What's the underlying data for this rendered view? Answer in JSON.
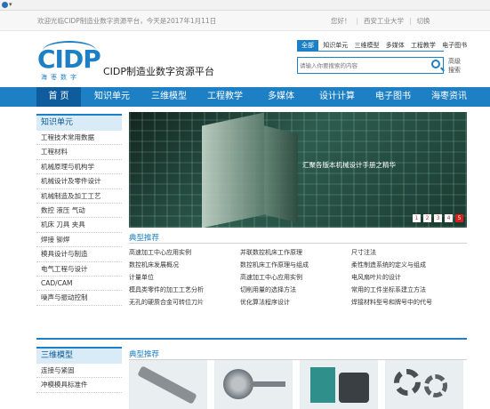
{
  "top": {
    "welcome": "欢迎光临CIDP制造业数字资源平台，今天是2017年1月11日",
    "greeting": "您好！",
    "org": "西安工业大学",
    "switch": "切换"
  },
  "logo": {
    "mark": "CIDP",
    "sub": "海枣数字"
  },
  "site_title": "CIDP制造业数字资源平台",
  "search": {
    "tabs": [
      "全部",
      "知识单元",
      "三维模型",
      "多媒体",
      "工程教学",
      "电子图书"
    ],
    "placeholder": "请输入你要搜索的内容",
    "advanced": "高级搜索"
  },
  "nav": [
    "首 页",
    "知识单元",
    "三维模型",
    "工程教学",
    "多媒体",
    "设计计算",
    "电子图书",
    "海枣资讯"
  ],
  "sidebar1": {
    "title": "知识单元",
    "items": [
      "工程技术常用数据",
      "工程材料",
      "机械原理与机构学",
      "机械设计及零件设计",
      "机械制造及加工工艺",
      "数控 液压 气动",
      "机床 刀具 夹具",
      "焊接 铆焊",
      "模具设计与制造",
      "电气工程与设计",
      "CAD/CAM",
      "噪声与振动控制"
    ]
  },
  "banner": {
    "caption": "汇聚各版本机械设计手册之精华",
    "pages": [
      "1",
      "2",
      "3",
      "4",
      "5"
    ]
  },
  "rec1": {
    "title": "典型推荐",
    "items": [
      "高速加工中心应用实例",
      "并联数控机床工作原理",
      "尺寸注法",
      "数控机床发展概况",
      "数控机床工作原理与组成",
      "柔性制造系统的定义与组成",
      "计量单位",
      "高速加工中心应用实例",
      "电风扇叶片的设计",
      "模具类零件的加工工艺分析",
      "切削用量的选择方法",
      "常用的工件坐标系建立方法",
      "无孔的硬质合金可转位刀片",
      "优化算法程序设计",
      "焊接材料型号和牌号中的代号"
    ]
  },
  "sidebar2": {
    "title": "三维模型",
    "items": [
      "连接与紧固",
      "冲模模具标准件"
    ]
  },
  "rec2": {
    "title": "典型推荐"
  },
  "colors": {
    "primary": "#1d7fc4",
    "nav_active": "#0f5c9c",
    "page_active": "#d91e1e"
  }
}
